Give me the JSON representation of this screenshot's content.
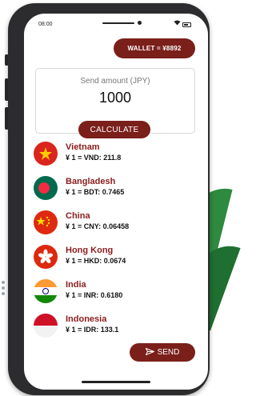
{
  "status": {
    "time": "08:00"
  },
  "wallet": {
    "label": "WALLET = ¥8892"
  },
  "amount_card": {
    "label": "Send amount (JPY)",
    "value": "1000"
  },
  "calculate": {
    "label": "CALCULATE"
  },
  "rates": [
    {
      "country": "Vietnam",
      "rate": "¥ 1 = VND: 211.8",
      "flag": "vietnam-flag-icon"
    },
    {
      "country": "Bangladesh",
      "rate": "¥ 1 = BDT: 0.7465",
      "flag": "bangladesh-flag-icon"
    },
    {
      "country": "China",
      "rate": "¥ 1 = CNY: 0.06458",
      "flag": "china-flag-icon"
    },
    {
      "country": "Hong Kong",
      "rate": "¥ 1 = HKD: 0.0674",
      "flag": "hong-kong-flag-icon"
    },
    {
      "country": "India",
      "rate": "¥ 1 = INR: 0.6180",
      "flag": "india-flag-icon"
    },
    {
      "country": "Indonesia",
      "rate": "¥ 1 = IDR: 133.1",
      "flag": "indonesia-flag-icon"
    }
  ],
  "send": {
    "label": "SEND",
    "icon": "send-icon"
  },
  "colors": {
    "accent": "#7a1f1a",
    "country_text": "#8a1c1c",
    "phone_frame": "#2c2c2e"
  }
}
